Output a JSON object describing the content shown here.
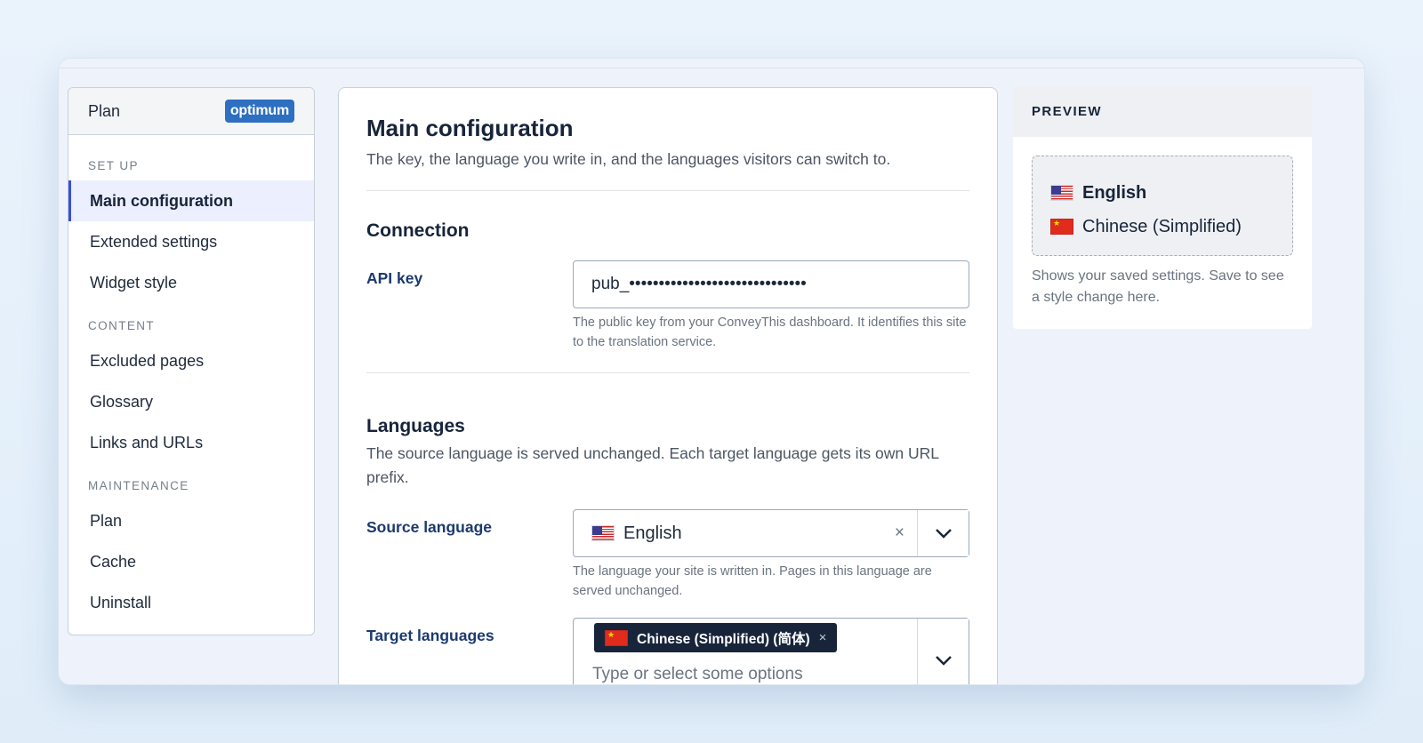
{
  "sidebar": {
    "plan_label": "Plan",
    "plan_badge": "optimum",
    "groups": [
      {
        "label": "SET UP",
        "items": [
          "Main configuration",
          "Extended settings",
          "Widget style"
        ]
      },
      {
        "label": "CONTENT",
        "items": [
          "Excluded pages",
          "Glossary",
          "Links and URLs"
        ]
      },
      {
        "label": "MAINTENANCE",
        "items": [
          "Plan",
          "Cache",
          "Uninstall"
        ]
      }
    ],
    "active_item": "Main configuration"
  },
  "main": {
    "title": "Main configuration",
    "description": "The key, the language you write in, and the languages visitors can switch to.",
    "connection": {
      "heading": "Connection",
      "api_key_label": "API key",
      "api_key_value": "pub_••••••••••••••••••••••••••••••",
      "api_key_help": "The public key from your ConveyThis dashboard. It identifies this site to the translation service."
    },
    "languages": {
      "heading": "Languages",
      "description": "The source language is served unchanged. Each target language gets its own URL prefix.",
      "source_label": "Source language",
      "source_value": "English",
      "source_flag": "us-flag",
      "source_clear": "×",
      "source_help": "The language your site is written in. Pages in this language are served unchanged.",
      "target_label": "Target languages",
      "target_chip": "Chinese (Simplified) (简体)",
      "target_chip_remove": "×",
      "target_flag": "cn-flag",
      "target_placeholder": "Type or select some options"
    }
  },
  "preview": {
    "heading": "PREVIEW",
    "languages": [
      "English",
      "Chinese (Simplified)"
    ],
    "note": "Shows your saved settings. Save to see a style change here."
  },
  "colors": {
    "accent": "#3a4fd3",
    "badge": "#2d6fc1",
    "chip": "#17243a",
    "label": "#1c3a6e"
  }
}
